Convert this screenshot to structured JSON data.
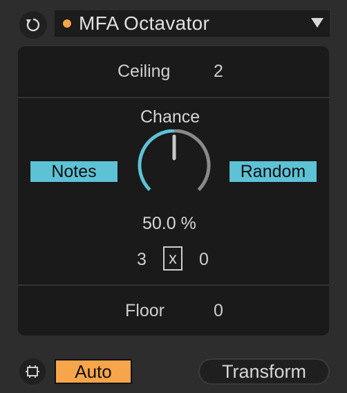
{
  "header": {
    "device_name": "MFA Octavator",
    "refresh_icon": "refresh-icon",
    "dropdown_icon": "chevron-down-icon",
    "status_color": "#f6a54a"
  },
  "ceiling": {
    "label": "Ceiling",
    "value": "2"
  },
  "chance": {
    "label": "Chance",
    "value": "50.0 %",
    "level": 0.5
  },
  "buttons": {
    "notes": "Notes",
    "random": "Random"
  },
  "range": {
    "left": "3",
    "multiplier": "x",
    "right": "0"
  },
  "floor": {
    "label": "Floor",
    "value": "0"
  },
  "footer": {
    "device_icon": "device-map-icon",
    "auto": "Auto",
    "transform": "Transform"
  },
  "colors": {
    "accent_blue": "#5dc2d6",
    "accent_orange": "#f6a54a",
    "panel": "#1a1a1a",
    "background": "#2d2d2d"
  }
}
